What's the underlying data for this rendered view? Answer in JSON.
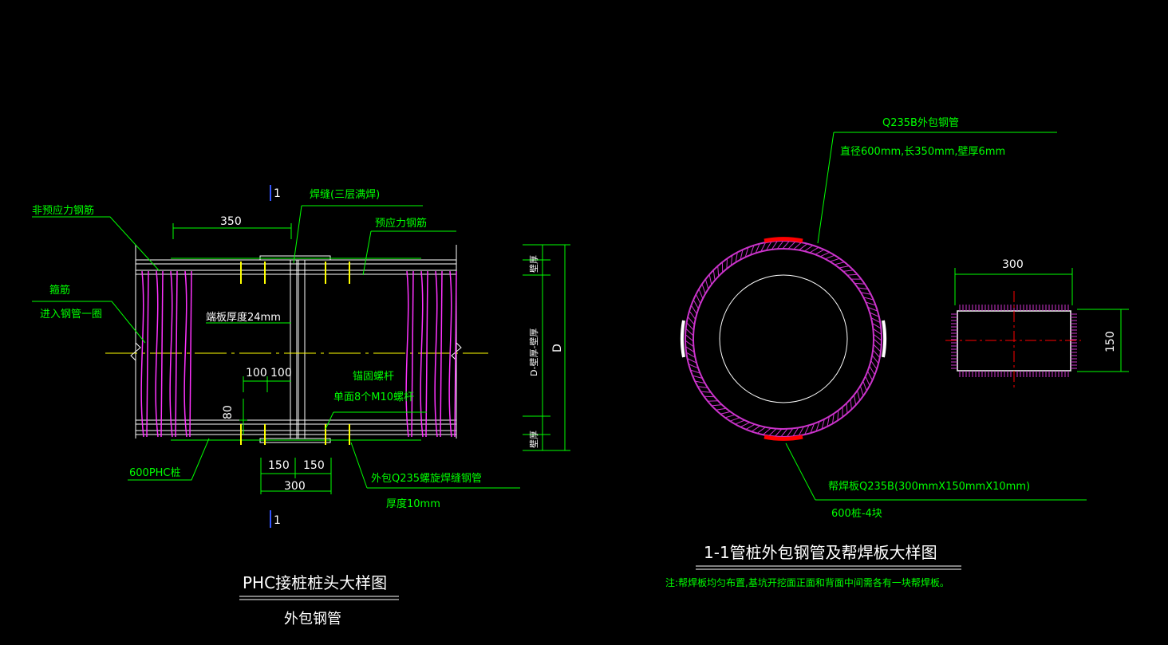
{
  "colors": {
    "background": "#000000",
    "annotation": "#00ff00",
    "line": "#ffffff",
    "pink": "#ff33ff",
    "hatch": "#cc33cc",
    "yellow": "#ffff00",
    "red": "#ff0000",
    "blue": "#3355ff"
  },
  "left": {
    "section_mark_top": "1",
    "section_mark_bottom": "1",
    "weld_label": "焊缝(三层满焊)",
    "nonprestress_label": "非预应力钢筋",
    "prestress_label": "预应力钢筋",
    "stirrup_label": "箍筋",
    "stirrup_sub": "进入钢管一圈",
    "endplate_label": "端板厚度24mm",
    "anchor_label": "锚固螺杆",
    "anchor_sub": "单面8个M10螺杆",
    "pile_label": "600PHC桩",
    "pipe_label": "外包Q235螺旋焊缝钢管",
    "pipe_sub": "厚度10mm",
    "dim_350": "350",
    "dim_100a": "100",
    "dim_100b": "100",
    "dim_80": "80",
    "dim_150a": "150",
    "dim_150b": "150",
    "dim_300": "300",
    "side_dim_top": "壁厚",
    "side_dim_mid": "D-壁厚-壁厚",
    "side_dim_bottom": "壁厚",
    "side_dim_D": "D",
    "title": "PHC接桩桩头大样图",
    "subtitle": "外包钢管"
  },
  "right": {
    "pipe_label": "Q235B外包钢管",
    "pipe_spec": "直径600mm,长350mm,壁厚6mm",
    "plate_label": "帮焊板Q235B(300mmX150mmX10mm)",
    "plate_count": "600桩-4块",
    "dim_300": "300",
    "dim_150": "150",
    "title": "1-1管桩外包钢管及帮焊板大样图",
    "note": "注:帮焊板均匀布置,基坑开挖面正面和背面中间需各有一块帮焊板。"
  }
}
